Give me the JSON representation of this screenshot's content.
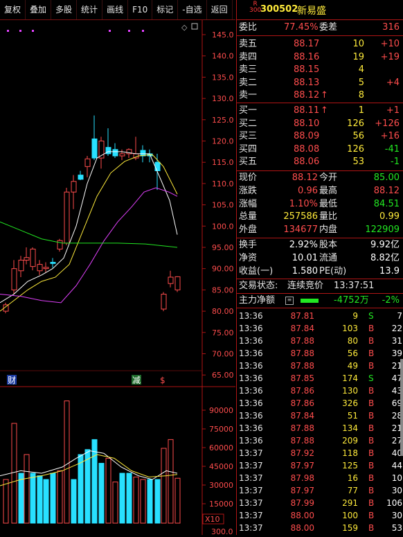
{
  "toolbar": [
    "复权",
    "叠加",
    "多股",
    "统计",
    "画线",
    "F10",
    "标记",
    "-自选",
    "返回"
  ],
  "chart": {
    "price_axis": [
      "145.0",
      "140.0",
      "135.0",
      "130.0",
      "125.0",
      "120.0",
      "115.0",
      "110.0",
      "105.0",
      "100.0",
      "95.00",
      "90.00",
      "85.00",
      "80.00",
      "75.00",
      "70.00",
      "65.00"
    ],
    "vol_axis": [
      "90000",
      "75000",
      "60000",
      "45000",
      "30000",
      "15000"
    ],
    "vol_unit": "X10",
    "bottom_label": "300.0",
    "markers": {
      "cai": "财",
      "jian": "减",
      "s": "$"
    }
  },
  "stock": {
    "badge_top": "R",
    "badge_bot": "300",
    "code": "300502",
    "name": "新易盛"
  },
  "weibi": {
    "l1": "委比",
    "v1": "77.45%",
    "l2": "委差",
    "v2": "316"
  },
  "asks": [
    {
      "label": "卖五",
      "price": "88.17",
      "vol": "10",
      "chg": "+10"
    },
    {
      "label": "卖四",
      "price": "88.16",
      "vol": "19",
      "chg": "+19"
    },
    {
      "label": "卖三",
      "price": "88.15",
      "vol": "4",
      "chg": ""
    },
    {
      "label": "卖二",
      "price": "88.13",
      "vol": "5",
      "chg": "+4"
    },
    {
      "label": "卖一",
      "price": "88.12",
      "vol": "8",
      "chg": "",
      "arrow": "↑"
    }
  ],
  "bids": [
    {
      "label": "买一",
      "price": "88.11",
      "vol": "1",
      "chg": "+1",
      "arrow": "↑"
    },
    {
      "label": "买二",
      "price": "88.10",
      "vol": "126",
      "chg": "+126"
    },
    {
      "label": "买三",
      "price": "88.09",
      "vol": "56",
      "chg": "+16"
    },
    {
      "label": "买四",
      "price": "88.08",
      "vol": "126",
      "chg": "-41"
    },
    {
      "label": "买五",
      "price": "88.06",
      "vol": "53",
      "chg": "-1"
    }
  ],
  "quote": [
    {
      "l1": "现价",
      "v1": "88.12",
      "l2": "今开",
      "v2": "85.00"
    },
    {
      "l1": "涨跌",
      "v1": "0.96",
      "l2": "最高",
      "v2": "88.12"
    },
    {
      "l1": "涨幅",
      "v1": "1.10%",
      "l2": "最低",
      "v2": "84.51"
    },
    {
      "l1": "总量",
      "v1": "257586",
      "l2": "量比",
      "v2": "0.99"
    },
    {
      "l1": "外盘",
      "v1": "134677",
      "l2": "内盘",
      "v2": "122909"
    }
  ],
  "fin": [
    {
      "l1": "换手",
      "v1": "2.92%",
      "l2": "股本",
      "v2": "9.92亿"
    },
    {
      "l1": "净资",
      "v1": "10.01",
      "l2": "流通",
      "v2": "8.82亿"
    },
    {
      "l1": "收益(一)",
      "v1": "1.580",
      "l2": "PE(动)",
      "v2": "13.9"
    }
  ],
  "status": {
    "label": "交易状态:",
    "value": "连续竞价",
    "time": "13:37:51"
  },
  "main_force": {
    "label": "主力净额",
    "value": "-4752万",
    "pct": "-2%"
  },
  "ticks": [
    {
      "t": "13:36",
      "p": "87.81",
      "v": "9",
      "bs": "S",
      "n": "7"
    },
    {
      "t": "13:36",
      "p": "87.84",
      "v": "103",
      "bs": "B",
      "n": "22"
    },
    {
      "t": "13:36",
      "p": "87.88",
      "v": "80",
      "bs": "B",
      "n": "31"
    },
    {
      "t": "13:36",
      "p": "87.88",
      "v": "56",
      "bs": "B",
      "n": "39"
    },
    {
      "t": "13:36",
      "p": "87.88",
      "v": "49",
      "bs": "B",
      "n": "21"
    },
    {
      "t": "13:36",
      "p": "87.85",
      "v": "174",
      "bs": "S",
      "n": "47"
    },
    {
      "t": "13:36",
      "p": "87.86",
      "v": "130",
      "bs": "B",
      "n": "43"
    },
    {
      "t": "13:36",
      "p": "87.86",
      "v": "326",
      "bs": "B",
      "n": "69"
    },
    {
      "t": "13:36",
      "p": "87.84",
      "v": "51",
      "bs": "B",
      "n": "28"
    },
    {
      "t": "13:36",
      "p": "87.88",
      "v": "134",
      "bs": "B",
      "n": "21"
    },
    {
      "t": "13:36",
      "p": "87.88",
      "v": "209",
      "bs": "B",
      "n": "27"
    },
    {
      "t": "13:37",
      "p": "87.92",
      "v": "118",
      "bs": "B",
      "n": "40"
    },
    {
      "t": "13:37",
      "p": "87.97",
      "v": "125",
      "bs": "B",
      "n": "44"
    },
    {
      "t": "13:37",
      "p": "87.98",
      "v": "16",
      "bs": "B",
      "n": "10"
    },
    {
      "t": "13:37",
      "p": "87.97",
      "v": "77",
      "bs": "B",
      "n": "30"
    },
    {
      "t": "13:37",
      "p": "87.99",
      "v": "291",
      "bs": "B",
      "n": "106"
    },
    {
      "t": "13:37",
      "p": "88.00",
      "v": "100",
      "bs": "B",
      "n": "30"
    },
    {
      "t": "13:37",
      "p": "88.00",
      "v": "159",
      "bs": "B",
      "n": "53"
    }
  ],
  "colors": {
    "up": "#ff4d4d",
    "down": "#28e0ff",
    "ma5": "#ffffff",
    "ma10": "#ffeb3b",
    "ma20": "#e040fb",
    "ma60": "#22e822"
  }
}
